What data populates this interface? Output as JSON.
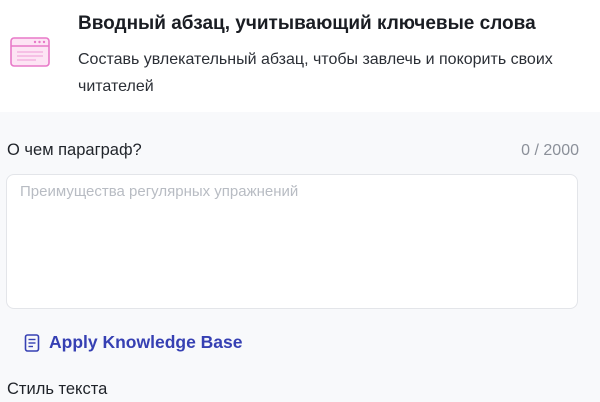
{
  "header": {
    "icon": "browser-window-icon",
    "title": "Вводный абзац, учитывающий ключевые слова",
    "description": "Составь увлекательный абзац, чтобы завлечь и покорить своих читателей"
  },
  "paragraph_field": {
    "label": "О чем параграф?",
    "counter": "0 / 2000",
    "value": "",
    "placeholder": "Преимущества регулярных упражнений"
  },
  "knowledge_base": {
    "icon": "document-icon",
    "label": "Apply Knowledge Base"
  },
  "style_section": {
    "label": "Стиль текста"
  },
  "colors": {
    "accent": "#3640b3",
    "icon_pink": "#e879c8",
    "icon_fill": "#fde4f4"
  }
}
